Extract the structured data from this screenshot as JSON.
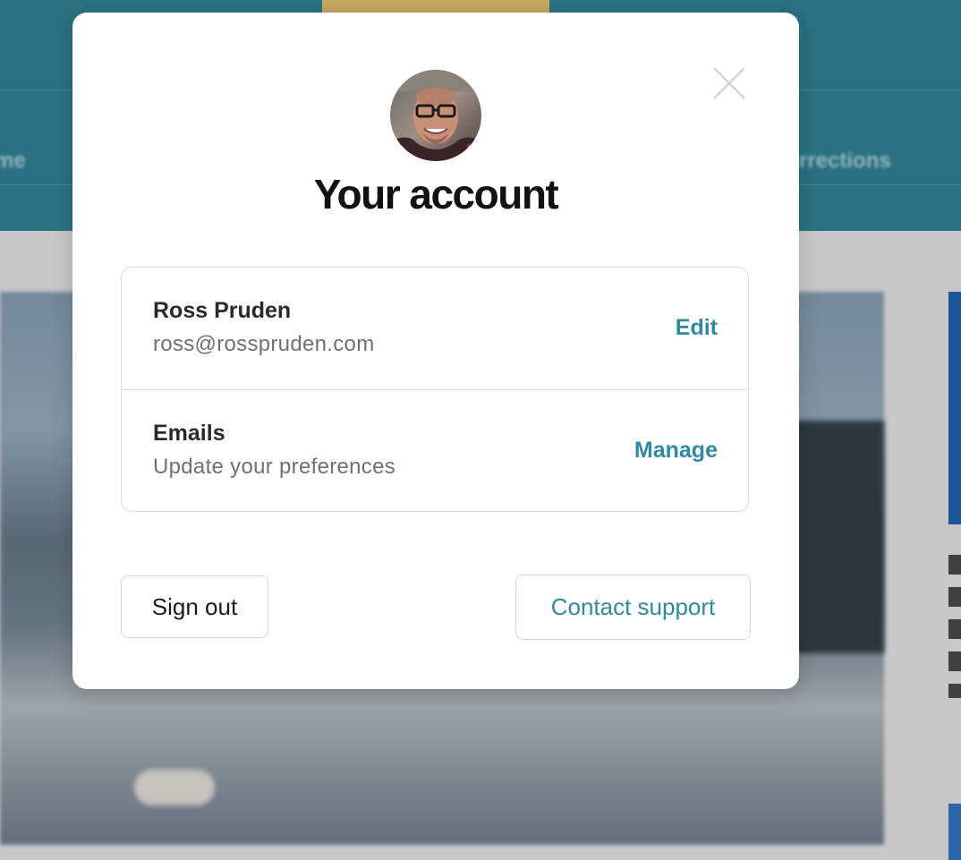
{
  "background": {
    "nav_left_fragment": "me",
    "nav_right_fragment": "rrections"
  },
  "modal": {
    "title": "Your account",
    "close_icon": "close-icon",
    "avatar_icon": "user-avatar-photo",
    "profile": {
      "name": "Ross Pruden",
      "email": "ross@rosspruden.com",
      "action_label": "Edit"
    },
    "emails": {
      "title": "Emails",
      "subtitle": "Update your preferences",
      "action_label": "Manage"
    },
    "buttons": {
      "sign_out": "Sign out",
      "contact_support": "Contact support"
    }
  },
  "colors": {
    "accent": "#2e8aa1",
    "header_bg": "#2e7c8f",
    "title_text": "#111111"
  }
}
